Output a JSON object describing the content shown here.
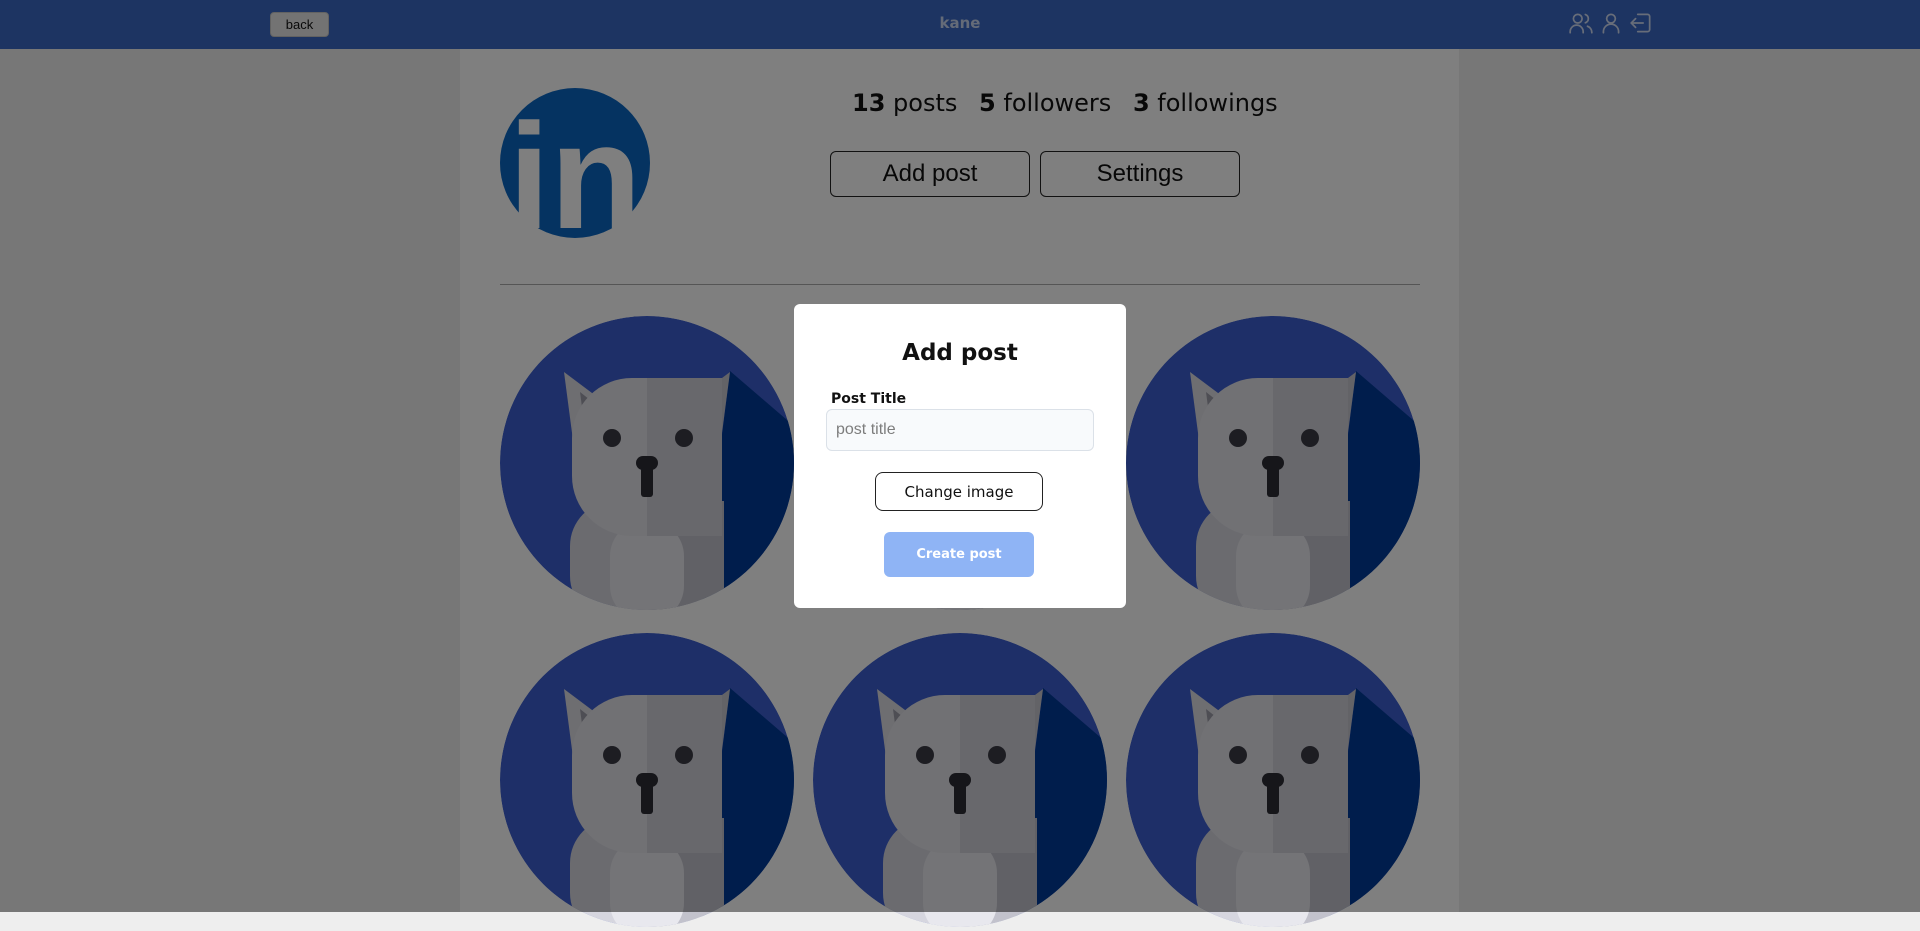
{
  "header": {
    "back_label": "back",
    "brand": "kane",
    "icons": [
      "users-icon",
      "user-icon",
      "logout-icon"
    ]
  },
  "profile": {
    "avatar_logo": "in",
    "stats": {
      "posts_count": "13",
      "posts_label": "posts",
      "followers_count": "5",
      "followers_label": "followers",
      "followings_count": "3",
      "followings_label": "followings"
    },
    "add_post_label": "Add post",
    "settings_label": "Settings"
  },
  "posts": [
    {
      "image": "cat-avatar"
    },
    {
      "image": "cat-avatar"
    },
    {
      "image": "cat-avatar"
    },
    {
      "image": "cat-avatar"
    },
    {
      "image": "cat-avatar"
    },
    {
      "image": "cat-avatar"
    }
  ],
  "modal": {
    "title": "Add post",
    "field_label": "Post Title",
    "field_placeholder": "post title",
    "field_value": "",
    "change_image_label": "Change image",
    "create_label": "Create post"
  },
  "colors": {
    "header_bg": "#3b68c5",
    "create_button_bg": "#8fb4f5",
    "post_circle": "#3d5fd0",
    "post_shadow": "#003a99",
    "logo_blue": "#0a66c2"
  }
}
